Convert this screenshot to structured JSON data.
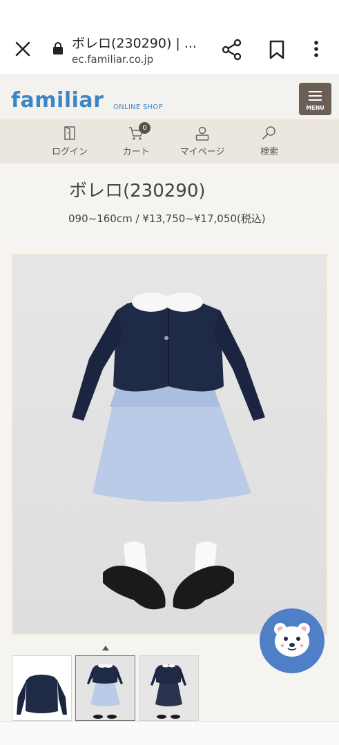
{
  "browser": {
    "tab_title": "ボレロ(230290) | ...",
    "url": "ec.familiar.co.jp"
  },
  "site": {
    "logo": "familiar",
    "logo_sub": "ONLINE SHOP",
    "menu_label": "MENU",
    "brand_color": "#3d86c6"
  },
  "nav": {
    "items": [
      {
        "label": "ログイン",
        "icon": "login-door-icon"
      },
      {
        "label": "カート",
        "icon": "cart-icon",
        "badge": "0"
      },
      {
        "label": "マイページ",
        "icon": "user-icon"
      },
      {
        "label": "検索",
        "icon": "search-icon"
      }
    ]
  },
  "product": {
    "name": "ボレロ(230290)",
    "price": "090~160cm / ¥13,750~¥17,050(税込)"
  },
  "gallery": {
    "thumbnail_count": 3,
    "active_index": 1
  },
  "colors": {
    "header_bg": "#f4f2ee",
    "nav_bg": "#ebe7df",
    "menu_button": "#6b5f55",
    "chat_button": "#4f7fc7"
  }
}
